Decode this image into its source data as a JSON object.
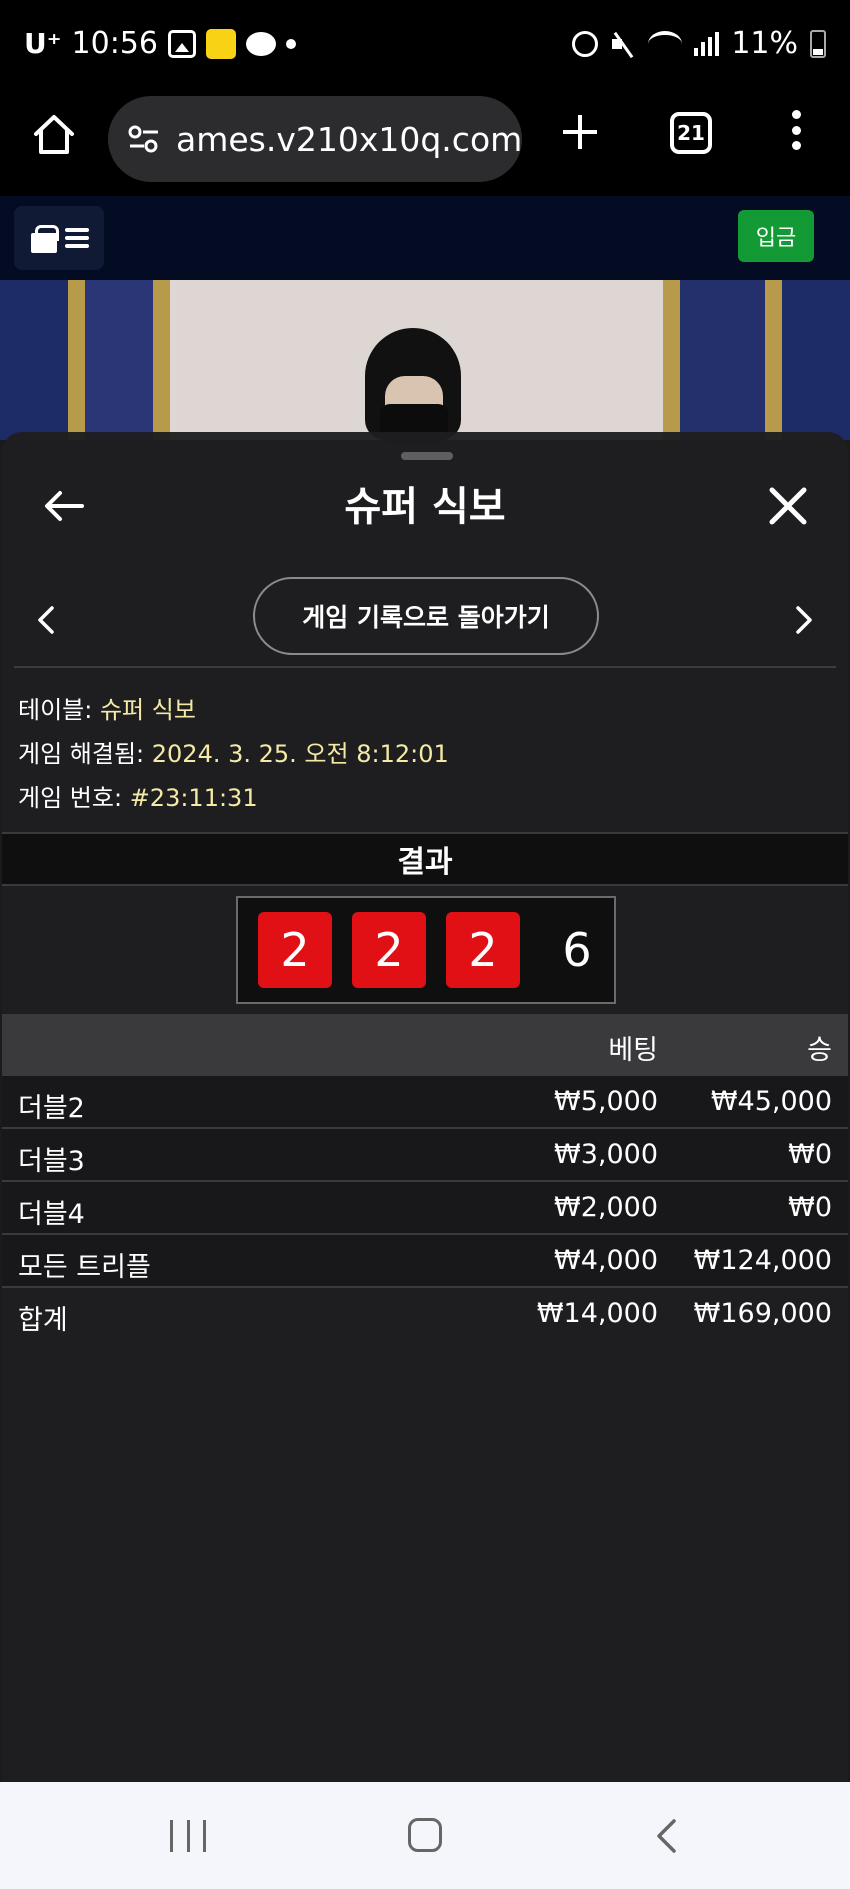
{
  "status_bar": {
    "carrier": "U⁺",
    "time": "10:56",
    "battery": "11%"
  },
  "browser": {
    "url": "ames.v210x10q.com",
    "tab_count": "21"
  },
  "site_header": {
    "deposit_label": "입금"
  },
  "sheet": {
    "title": "슈퍼 식보",
    "back_to_history_label": "게임 기록으로 돌아가기",
    "info": {
      "table_label": "테이블:",
      "table_value": "슈퍼 식보",
      "resolved_label": "게임 해결됨:",
      "resolved_value": "2024. 3. 25. 오전 8:12:01",
      "game_no_label": "게임 번호:",
      "game_no_value": "#23:11:31"
    },
    "result_label": "결과",
    "dice": [
      "2",
      "2",
      "2"
    ],
    "dice_sum": "6",
    "columns": {
      "bet": "베팅",
      "win": "승"
    },
    "rows": [
      {
        "name": "더블2",
        "bet": "₩5,000",
        "win": "₩45,000"
      },
      {
        "name": "더블3",
        "bet": "₩3,000",
        "win": "₩0"
      },
      {
        "name": "더블4",
        "bet": "₩2,000",
        "win": "₩0"
      },
      {
        "name": "모든 트리플",
        "bet": "₩4,000",
        "win": "₩124,000"
      }
    ],
    "total": {
      "name": "합계",
      "bet": "₩14,000",
      "win": "₩169,000"
    }
  },
  "colors": {
    "accent_green": "#139a35",
    "dice_red": "#e01015",
    "info_value": "#f4eaa6"
  }
}
